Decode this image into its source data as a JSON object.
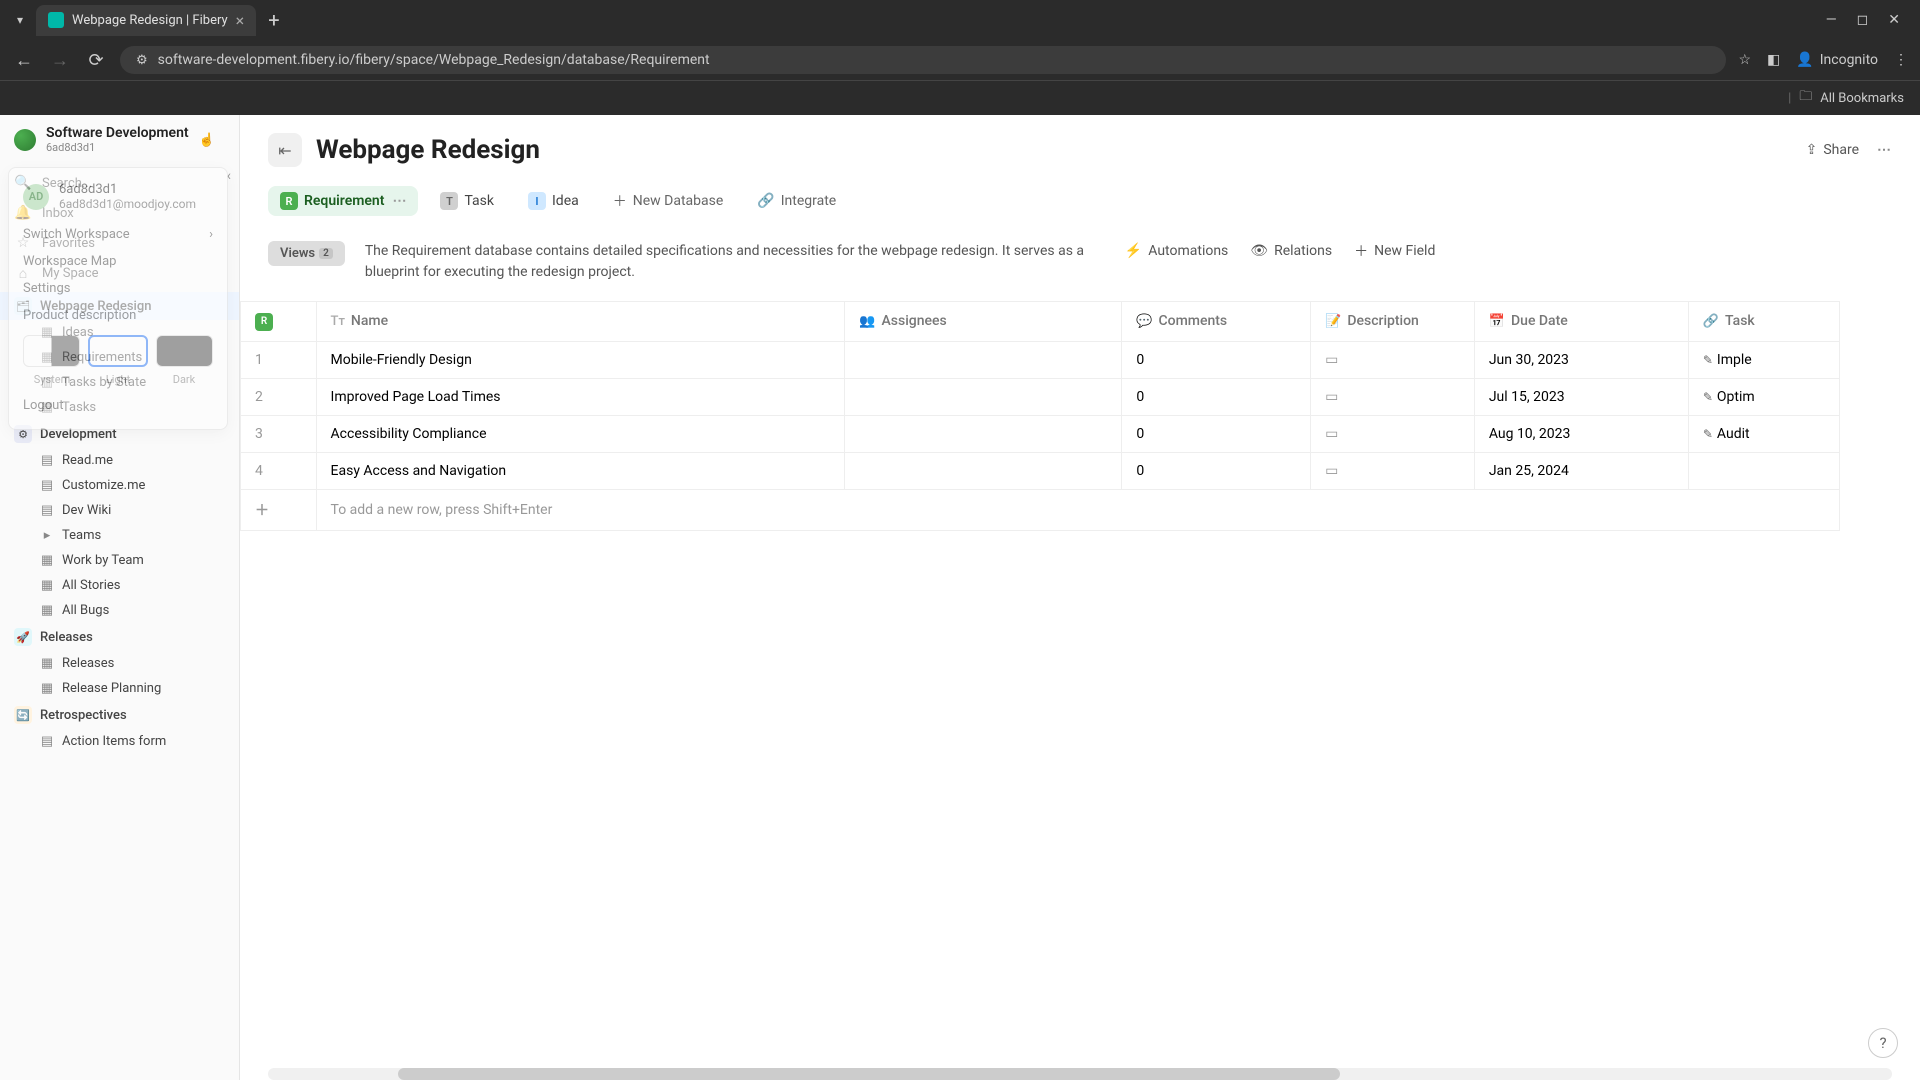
{
  "browser": {
    "tab_title": "Webpage Redesign | Fibery",
    "url": "software-development.fibery.io/fibery/space/Webpage_Redesign/database/Requirement",
    "incognito": "Incognito",
    "all_bookmarks": "All Bookmarks"
  },
  "workspace": {
    "name": "Software Development",
    "id": "6ad8d3d1"
  },
  "sidebar_nav": {
    "search": "Search...",
    "inbox": "Inbox",
    "favorites": "Favorites",
    "myspace": "My Space"
  },
  "popup": {
    "avatar": "AD",
    "user_name": "6ad8d3d1",
    "user_email": "6ad8d3d1@moodjoy.com",
    "switch_ws": "Switch Workspace",
    "ws_map": "Workspace Map",
    "settings": "Settings",
    "product_desc": "Product description",
    "theme_system": "System",
    "theme_light": "Light",
    "theme_dark": "Dark",
    "logout": "Logout"
  },
  "tree": {
    "spaces": [
      {
        "name": "Webpage Redesign",
        "children": [
          "Ideas",
          "Requirements",
          "Tasks by State",
          "Tasks"
        ]
      },
      {
        "name": "Development",
        "children": [
          "Read.me",
          "Customize.me",
          "Dev Wiki",
          "Teams",
          "Work by Team",
          "All Stories",
          "All Bugs"
        ]
      },
      {
        "name": "Releases",
        "children": [
          "Releases",
          "Release Planning"
        ]
      },
      {
        "name": "Retrospectives",
        "children": [
          "Action Items form"
        ]
      }
    ]
  },
  "page": {
    "title": "Webpage Redesign",
    "share": "Share"
  },
  "db_tabs": {
    "requirement": "Requirement",
    "task": "Task",
    "idea": "Idea",
    "new_db": "New Database",
    "integrate": "Integrate"
  },
  "views": {
    "label": "Views",
    "count": "2",
    "description": "The Requirement database contains detailed specifications and necessities for the webpage redesign. It serves as a blueprint for executing the redesign project.",
    "automations": "Automations",
    "relations": "Relations",
    "new_field": "New Field"
  },
  "table": {
    "columns": {
      "name": "Name",
      "assignees": "Assignees",
      "comments": "Comments",
      "description": "Description",
      "due_date": "Due Date",
      "task": "Task"
    },
    "rows": [
      {
        "idx": "1",
        "name": "Mobile-Friendly Design",
        "assignees": "",
        "comments": "0",
        "due": "Jun 30, 2023",
        "task": "Imple"
      },
      {
        "idx": "2",
        "name": "Improved Page Load Times",
        "assignees": "",
        "comments": "0",
        "due": "Jul 15, 2023",
        "task": "Optim"
      },
      {
        "idx": "3",
        "name": "Accessibility Compliance",
        "assignees": "",
        "comments": "0",
        "due": "Aug 10, 2023",
        "task": "Audit"
      },
      {
        "idx": "4",
        "name": "Easy Access and Navigation",
        "assignees": "",
        "comments": "0",
        "due": "Jan 25, 2024",
        "task": ""
      }
    ],
    "add_row_hint": "To add a new row, press Shift+Enter"
  },
  "help_label": "?"
}
